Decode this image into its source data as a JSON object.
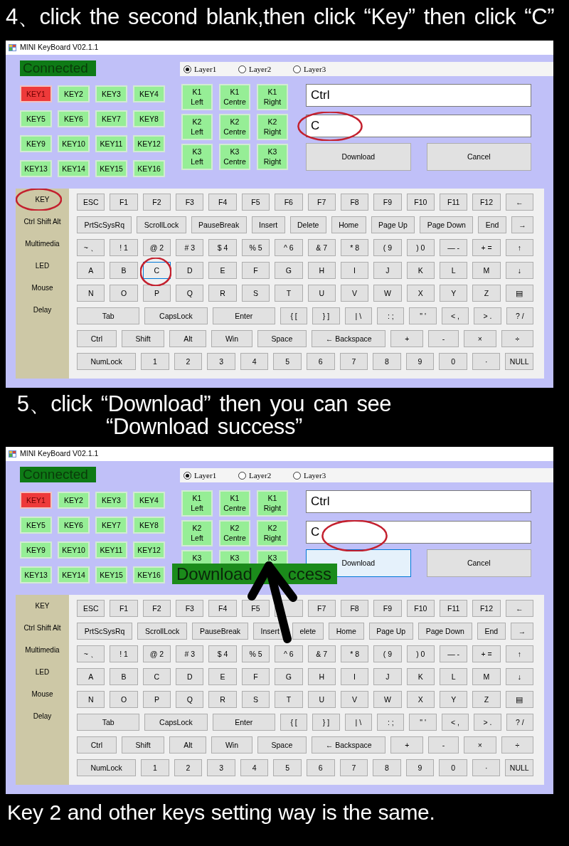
{
  "steps": [
    {
      "heading": "4、click the second blank,then click “Key” then click “C”",
      "window": {
        "title": "MINI KeyBoard V02.1.1",
        "status": "Connected",
        "layers": [
          {
            "label": "Layer1",
            "selected": true
          },
          {
            "label": "Layer2",
            "selected": false
          },
          {
            "label": "Layer3",
            "selected": false
          }
        ],
        "slots": [
          {
            "label": "KEY1",
            "selected": true
          },
          {
            "label": "KEY2",
            "selected": false
          },
          {
            "label": "KEY3",
            "selected": false
          },
          {
            "label": "KEY4",
            "selected": false
          },
          {
            "label": "KEY5",
            "selected": false
          },
          {
            "label": "KEY6",
            "selected": false
          },
          {
            "label": "KEY7",
            "selected": false
          },
          {
            "label": "KEY8",
            "selected": false
          },
          {
            "label": "KEY9",
            "selected": false
          },
          {
            "label": "KEY10",
            "selected": false
          },
          {
            "label": "KEY11",
            "selected": false
          },
          {
            "label": "KEY12",
            "selected": false
          },
          {
            "label": "KEY13",
            "selected": false
          },
          {
            "label": "KEY14",
            "selected": false
          },
          {
            "label": "KEY15",
            "selected": false
          },
          {
            "label": "KEY16",
            "selected": false
          }
        ],
        "knob_buttons": [
          {
            "label": "K1 Left"
          },
          {
            "label": "K1 Centre"
          },
          {
            "label": "K1 Right"
          },
          {
            "label": "K2 Left"
          },
          {
            "label": "K2 Centre"
          },
          {
            "label": "K2 Right"
          },
          {
            "label": "K3 Left"
          },
          {
            "label": "K3 Centre"
          },
          {
            "label": "K3 Right"
          }
        ],
        "fields": [
          {
            "value": "Ctrl",
            "circled": false
          },
          {
            "value": "C",
            "circled": true
          }
        ],
        "buttons": [
          {
            "label": "Download",
            "focused": false
          },
          {
            "label": "Cancel",
            "focused": false
          }
        ],
        "sidebar": [
          {
            "label": "KEY",
            "circled": true
          },
          {
            "label": "Ctrl Shift Alt",
            "circled": false
          },
          {
            "label": "Multimedia",
            "circled": false
          },
          {
            "label": "LED",
            "circled": false
          },
          {
            "label": "Mouse",
            "circled": false
          },
          {
            "label": "Delay",
            "circled": false
          }
        ],
        "keyboard": [
          [
            {
              "label": "ESC",
              "selected": false,
              "circled": false
            },
            {
              "label": "F1",
              "selected": false,
              "circled": false
            },
            {
              "label": "F2",
              "selected": false,
              "circled": false
            },
            {
              "label": "F3",
              "selected": false,
              "circled": false
            },
            {
              "label": "F4",
              "selected": false,
              "circled": false
            },
            {
              "label": "F5",
              "selected": false,
              "circled": false
            },
            {
              "label": "F6",
              "selected": false,
              "circled": false
            },
            {
              "label": "F7",
              "selected": false,
              "circled": false
            },
            {
              "label": "F8",
              "selected": false,
              "circled": false
            },
            {
              "label": "F9",
              "selected": false,
              "circled": false
            },
            {
              "label": "F10",
              "selected": false,
              "circled": false
            },
            {
              "label": "F11",
              "selected": false,
              "circled": false
            },
            {
              "label": "F12",
              "selected": false,
              "circled": false
            },
            {
              "label": "←",
              "selected": false,
              "circled": false
            }
          ],
          [
            {
              "label": "PrtScSysRq",
              "selected": false,
              "circled": false
            },
            {
              "label": "ScrollLock",
              "selected": false,
              "circled": false
            },
            {
              "label": "PauseBreak",
              "selected": false,
              "circled": false
            },
            {
              "label": "Insert",
              "selected": false,
              "circled": false
            },
            {
              "label": "Delete",
              "selected": false,
              "circled": false
            },
            {
              "label": "Home",
              "selected": false,
              "circled": false
            },
            {
              "label": "Page Up",
              "selected": false,
              "circled": false
            },
            {
              "label": "Page Down",
              "selected": false,
              "circled": false
            },
            {
              "label": "End",
              "selected": false,
              "circled": false
            },
            {
              "label": "→",
              "selected": false,
              "circled": false
            }
          ],
          [
            {
              "label": "~ 、",
              "selected": false,
              "circled": false
            },
            {
              "label": "! 1",
              "selected": false,
              "circled": false
            },
            {
              "label": "@ 2",
              "selected": false,
              "circled": false
            },
            {
              "label": "# 3",
              "selected": false,
              "circled": false
            },
            {
              "label": "$ 4",
              "selected": false,
              "circled": false
            },
            {
              "label": "% 5",
              "selected": false,
              "circled": false
            },
            {
              "label": "^ 6",
              "selected": false,
              "circled": false
            },
            {
              "label": "& 7",
              "selected": false,
              "circled": false
            },
            {
              "label": "* 8",
              "selected": false,
              "circled": false
            },
            {
              "label": "( 9",
              "selected": false,
              "circled": false
            },
            {
              "label": ") 0",
              "selected": false,
              "circled": false
            },
            {
              "label": "— -",
              "selected": false,
              "circled": false
            },
            {
              "label": "+ =",
              "selected": false,
              "circled": false
            },
            {
              "label": "↑",
              "selected": false,
              "circled": false
            }
          ],
          [
            {
              "label": "A",
              "selected": false,
              "circled": false
            },
            {
              "label": "B",
              "selected": false,
              "circled": false
            },
            {
              "label": "C",
              "selected": true,
              "circled": true
            },
            {
              "label": "D",
              "selected": false,
              "circled": false
            },
            {
              "label": "E",
              "selected": false,
              "circled": false
            },
            {
              "label": "F",
              "selected": false,
              "circled": false
            },
            {
              "label": "G",
              "selected": false,
              "circled": false
            },
            {
              "label": "H",
              "selected": false,
              "circled": false
            },
            {
              "label": "I",
              "selected": false,
              "circled": false
            },
            {
              "label": "J",
              "selected": false,
              "circled": false
            },
            {
              "label": "K",
              "selected": false,
              "circled": false
            },
            {
              "label": "L",
              "selected": false,
              "circled": false
            },
            {
              "label": "M",
              "selected": false,
              "circled": false
            },
            {
              "label": "↓",
              "selected": false,
              "circled": false
            }
          ],
          [
            {
              "label": "N",
              "selected": false,
              "circled": false
            },
            {
              "label": "O",
              "selected": false,
              "circled": false
            },
            {
              "label": "P",
              "selected": false,
              "circled": false
            },
            {
              "label": "Q",
              "selected": false,
              "circled": false
            },
            {
              "label": "R",
              "selected": false,
              "circled": false
            },
            {
              "label": "S",
              "selected": false,
              "circled": false
            },
            {
              "label": "T",
              "selected": false,
              "circled": false
            },
            {
              "label": "U",
              "selected": false,
              "circled": false
            },
            {
              "label": "V",
              "selected": false,
              "circled": false
            },
            {
              "label": "W",
              "selected": false,
              "circled": false
            },
            {
              "label": "X",
              "selected": false,
              "circled": false
            },
            {
              "label": "Y",
              "selected": false,
              "circled": false
            },
            {
              "label": "Z",
              "selected": false,
              "circled": false
            },
            {
              "label": "▤",
              "selected": false,
              "circled": false
            }
          ],
          [
            {
              "label": "Tab",
              "selected": false,
              "circled": false
            },
            {
              "label": "CapsLock",
              "selected": false,
              "circled": false
            },
            {
              "label": "Enter",
              "selected": false,
              "circled": false
            },
            {
              "label": "{ [",
              "selected": false,
              "circled": false
            },
            {
              "label": "} ]",
              "selected": false,
              "circled": false
            },
            {
              "label": "| \\",
              "selected": false,
              "circled": false
            },
            {
              "label": ": ;",
              "selected": false,
              "circled": false
            },
            {
              "label": "\" '",
              "selected": false,
              "circled": false
            },
            {
              "label": "< ,",
              "selected": false,
              "circled": false
            },
            {
              "label": "> .",
              "selected": false,
              "circled": false
            },
            {
              "label": "? /",
              "selected": false,
              "circled": false
            }
          ],
          [
            {
              "label": "Ctrl",
              "selected": false,
              "circled": false
            },
            {
              "label": "Shift",
              "selected": false,
              "circled": false
            },
            {
              "label": "Alt",
              "selected": false,
              "circled": false
            },
            {
              "label": "Win",
              "selected": false,
              "circled": false
            },
            {
              "label": "Space",
              "selected": false,
              "circled": false
            },
            {
              "label": "← Backspace",
              "selected": false,
              "circled": false
            },
            {
              "label": "+",
              "selected": false,
              "circled": false
            },
            {
              "label": "-",
              "selected": false,
              "circled": false
            },
            {
              "label": "×",
              "selected": false,
              "circled": false
            },
            {
              "label": "÷",
              "selected": false,
              "circled": false
            }
          ],
          [
            {
              "label": "NumLock",
              "selected": false,
              "circled": false
            },
            {
              "label": "1",
              "selected": false,
              "circled": false
            },
            {
              "label": "2",
              "selected": false,
              "circled": false
            },
            {
              "label": "3",
              "selected": false,
              "circled": false
            },
            {
              "label": "4",
              "selected": false,
              "circled": false
            },
            {
              "label": "5",
              "selected": false,
              "circled": false
            },
            {
              "label": "6",
              "selected": false,
              "circled": false
            },
            {
              "label": "7",
              "selected": false,
              "circled": false
            },
            {
              "label": "8",
              "selected": false,
              "circled": false
            },
            {
              "label": "9",
              "selected": false,
              "circled": false
            },
            {
              "label": "0",
              "selected": false,
              "circled": false
            },
            {
              "label": "·",
              "selected": false,
              "circled": false
            },
            {
              "label": "NULL",
              "selected": false,
              "circled": false
            }
          ]
        ]
      }
    },
    {
      "heading": "5、click “Download” then you can see “Download success”",
      "window": {
        "title": "MINI KeyBoard V02.1.1",
        "status": "Connected",
        "layers": [
          {
            "label": "Layer1",
            "selected": true
          },
          {
            "label": "Layer2",
            "selected": false
          },
          {
            "label": "Layer3",
            "selected": false
          }
        ],
        "slots": [
          {
            "label": "KEY1",
            "selected": true
          },
          {
            "label": "KEY2",
            "selected": false
          },
          {
            "label": "KEY3",
            "selected": false
          },
          {
            "label": "KEY4",
            "selected": false
          },
          {
            "label": "KEY5",
            "selected": false
          },
          {
            "label": "KEY6",
            "selected": false
          },
          {
            "label": "KEY7",
            "selected": false
          },
          {
            "label": "KEY8",
            "selected": false
          },
          {
            "label": "KEY9",
            "selected": false
          },
          {
            "label": "KEY10",
            "selected": false
          },
          {
            "label": "KEY11",
            "selected": false
          },
          {
            "label": "KEY12",
            "selected": false
          },
          {
            "label": "KEY13",
            "selected": false
          },
          {
            "label": "KEY14",
            "selected": false
          },
          {
            "label": "KEY15",
            "selected": false
          },
          {
            "label": "KEY16",
            "selected": false
          }
        ],
        "knob_buttons": [
          {
            "label": "K1 Left"
          },
          {
            "label": "K1 Centre"
          },
          {
            "label": "K1 Right"
          },
          {
            "label": "K2 Left"
          },
          {
            "label": "K2 Centre"
          },
          {
            "label": "K2 Right"
          },
          {
            "label": "K3"
          },
          {
            "label": "K3"
          },
          {
            "label": "K3"
          }
        ],
        "fields": [
          {
            "value": "Ctrl",
            "circled": false
          },
          {
            "value": "C",
            "circled": true
          }
        ],
        "buttons": [
          {
            "label": "Download",
            "focused": true
          },
          {
            "label": "Cancel",
            "focused": false
          }
        ],
        "sidebar": [
          {
            "label": "KEY",
            "circled": false
          },
          {
            "label": "Ctrl Shift Alt",
            "circled": false
          },
          {
            "label": "Multimedia",
            "circled": false
          },
          {
            "label": "LED",
            "circled": false
          },
          {
            "label": "Mouse",
            "circled": false
          },
          {
            "label": "Delay",
            "circled": false
          }
        ],
        "keyboard": [
          [
            {
              "label": "ESC",
              "selected": false,
              "circled": false
            },
            {
              "label": "F1",
              "selected": false,
              "circled": false
            },
            {
              "label": "F2",
              "selected": false,
              "circled": false
            },
            {
              "label": "F3",
              "selected": false,
              "circled": false
            },
            {
              "label": "F4",
              "selected": false,
              "circled": false
            },
            {
              "label": "F5",
              "selected": false,
              "circled": false
            },
            {
              "selected": false,
              "circled": false
            },
            {
              "label": "F7",
              "selected": false,
              "circled": false
            },
            {
              "label": "F8",
              "selected": false,
              "circled": false
            },
            {
              "label": "F9",
              "selected": false,
              "circled": false
            },
            {
              "label": "F10",
              "selected": false,
              "circled": false
            },
            {
              "label": "F11",
              "selected": false,
              "circled": false
            },
            {
              "label": "F12",
              "selected": false,
              "circled": false
            },
            {
              "label": "←",
              "selected": false,
              "circled": false
            }
          ],
          [
            {
              "label": "PrtScSysRq",
              "selected": false,
              "circled": false
            },
            {
              "label": "ScrollLock",
              "selected": false,
              "circled": false
            },
            {
              "label": "PauseBreak",
              "selected": false,
              "circled": false
            },
            {
              "label": "Insert",
              "selected": false,
              "circled": false
            },
            {
              "label": "elete",
              "selected": false,
              "circled": false
            },
            {
              "label": "Home",
              "selected": false,
              "circled": false
            },
            {
              "label": "Page Up",
              "selected": false,
              "circled": false
            },
            {
              "label": "Page Down",
              "selected": false,
              "circled": false
            },
            {
              "label": "End",
              "selected": false,
              "circled": false
            },
            {
              "label": "→",
              "selected": false,
              "circled": false
            }
          ],
          [
            {
              "label": "~ 、",
              "selected": false,
              "circled": false
            },
            {
              "label": "! 1",
              "selected": false,
              "circled": false
            },
            {
              "label": "@ 2",
              "selected": false,
              "circled": false
            },
            {
              "label": "# 3",
              "selected": false,
              "circled": false
            },
            {
              "label": "$ 4",
              "selected": false,
              "circled": false
            },
            {
              "label": "% 5",
              "selected": false,
              "circled": false
            },
            {
              "label": "^ 6",
              "selected": false,
              "circled": false
            },
            {
              "label": "& 7",
              "selected": false,
              "circled": false
            },
            {
              "label": "* 8",
              "selected": false,
              "circled": false
            },
            {
              "label": "( 9",
              "selected": false,
              "circled": false
            },
            {
              "label": ") 0",
              "selected": false,
              "circled": false
            },
            {
              "label": "— -",
              "selected": false,
              "circled": false
            },
            {
              "label": "+ =",
              "selected": false,
              "circled": false
            },
            {
              "label": "↑",
              "selected": false,
              "circled": false
            }
          ],
          [
            {
              "label": "A",
              "selected": false,
              "circled": false
            },
            {
              "label": "B",
              "selected": false,
              "circled": false
            },
            {
              "label": "C",
              "selected": false,
              "circled": false
            },
            {
              "label": "D",
              "selected": false,
              "circled": false
            },
            {
              "label": "E",
              "selected": false,
              "circled": false
            },
            {
              "label": "F",
              "selected": false,
              "circled": false
            },
            {
              "label": "G",
              "selected": false,
              "circled": false
            },
            {
              "label": "H",
              "selected": false,
              "circled": false
            },
            {
              "label": "I",
              "selected": false,
              "circled": false
            },
            {
              "label": "J",
              "selected": false,
              "circled": false
            },
            {
              "label": "K",
              "selected": false,
              "circled": false
            },
            {
              "label": "L",
              "selected": false,
              "circled": false
            },
            {
              "label": "M",
              "selected": false,
              "circled": false
            },
            {
              "label": "↓",
              "selected": false,
              "circled": false
            }
          ],
          [
            {
              "label": "N",
              "selected": false,
              "circled": false
            },
            {
              "label": "O",
              "selected": false,
              "circled": false
            },
            {
              "label": "P",
              "selected": false,
              "circled": false
            },
            {
              "label": "Q",
              "selected": false,
              "circled": false
            },
            {
              "label": "R",
              "selected": false,
              "circled": false
            },
            {
              "label": "S",
              "selected": false,
              "circled": false
            },
            {
              "label": "T",
              "selected": false,
              "circled": false
            },
            {
              "label": "U",
              "selected": false,
              "circled": false
            },
            {
              "label": "V",
              "selected": false,
              "circled": false
            },
            {
              "label": "W",
              "selected": false,
              "circled": false
            },
            {
              "label": "X",
              "selected": false,
              "circled": false
            },
            {
              "label": "Y",
              "selected": false,
              "circled": false
            },
            {
              "label": "Z",
              "selected": false,
              "circled": false
            },
            {
              "label": "▤",
              "selected": false,
              "circled": false
            }
          ],
          [
            {
              "label": "Tab",
              "selected": false,
              "circled": false
            },
            {
              "label": "CapsLock",
              "selected": false,
              "circled": false
            },
            {
              "label": "Enter",
              "selected": false,
              "circled": false
            },
            {
              "label": "{ [",
              "selected": false,
              "circled": false
            },
            {
              "label": "} ]",
              "selected": false,
              "circled": false
            },
            {
              "label": "| \\",
              "selected": false,
              "circled": false
            },
            {
              "label": ": ;",
              "selected": false,
              "circled": false
            },
            {
              "label": "\" '",
              "selected": false,
              "circled": false
            },
            {
              "label": "< ,",
              "selected": false,
              "circled": false
            },
            {
              "label": "> .",
              "selected": false,
              "circled": false
            },
            {
              "label": "? /",
              "selected": false,
              "circled": false
            }
          ],
          [
            {
              "label": "Ctrl",
              "selected": false,
              "circled": false
            },
            {
              "label": "Shift",
              "selected": false,
              "circled": false
            },
            {
              "label": "Alt",
              "selected": false,
              "circled": false
            },
            {
              "label": "Win",
              "selected": false,
              "circled": false
            },
            {
              "label": "Space",
              "selected": false,
              "circled": false
            },
            {
              "label": "← Backspace",
              "selected": false,
              "circled": false
            },
            {
              "label": "+",
              "selected": false,
              "circled": false
            },
            {
              "label": "-",
              "selected": false,
              "circled": false
            },
            {
              "label": "×",
              "selected": false,
              "circled": false
            },
            {
              "label": "÷",
              "selected": false,
              "circled": false
            }
          ],
          [
            {
              "label": "NumLock",
              "selected": false,
              "circled": false
            },
            {
              "label": "1",
              "selected": false,
              "circled": false
            },
            {
              "label": "2",
              "selected": false,
              "circled": false
            },
            {
              "label": "3",
              "selected": false,
              "circled": false
            },
            {
              "label": "4",
              "selected": false,
              "circled": false
            },
            {
              "label": "5",
              "selected": false,
              "circled": false
            },
            {
              "label": "6",
              "selected": false,
              "circled": false
            },
            {
              "label": "7",
              "selected": false,
              "circled": false
            },
            {
              "label": "8",
              "selected": false,
              "circled": false
            },
            {
              "label": "9",
              "selected": false,
              "circled": false
            },
            {
              "label": "0",
              "selected": false,
              "circled": false
            },
            {
              "label": "·",
              "selected": false,
              "circled": false
            },
            {
              "label": "NULL",
              "selected": false,
              "circled": false
            }
          ]
        ],
        "toast": {
          "segments": [
            "Download",
            "ccess"
          ]
        },
        "pointer_arrow": true
      }
    }
  ],
  "footer": "Key 2 and other keys setting way is the same."
}
